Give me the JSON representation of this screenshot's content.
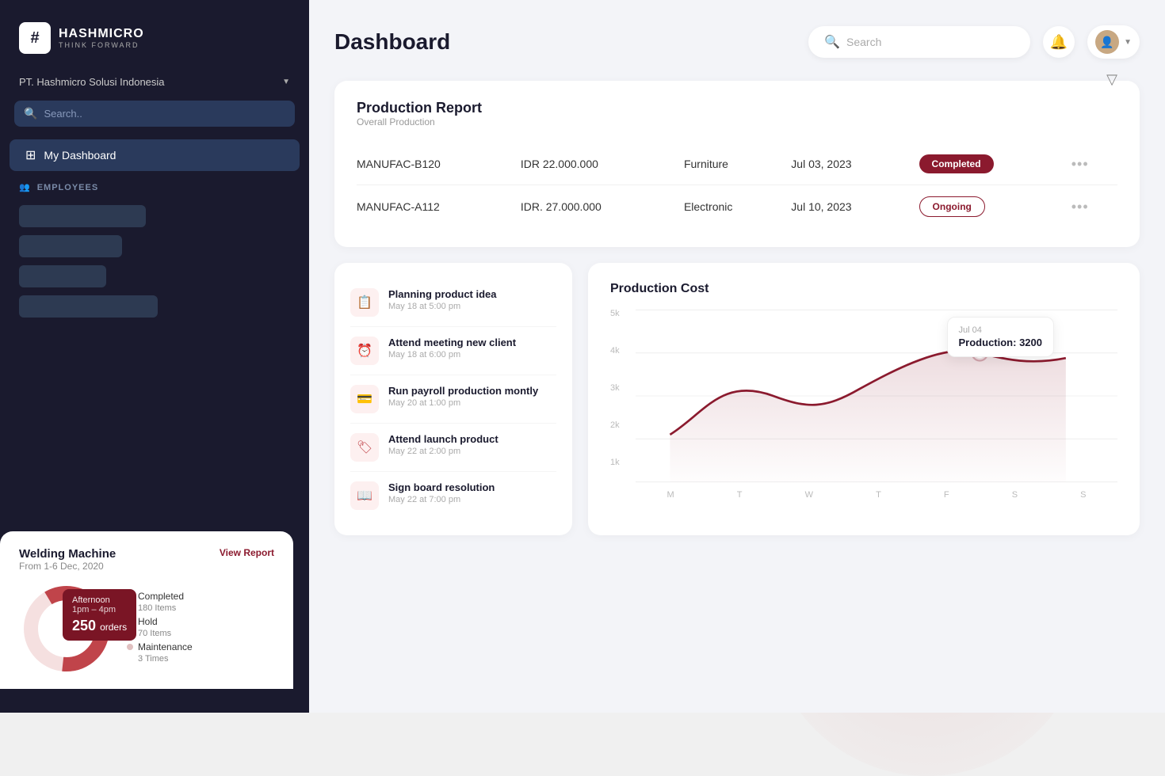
{
  "app": {
    "brand": "HASHMICRO",
    "tagline": "THINK FORWARD",
    "logo_hash": "#"
  },
  "sidebar": {
    "company": "PT. Hashmicro Solusi Indonesia",
    "search_placeholder": "Search..",
    "nav": [
      {
        "id": "dashboard",
        "label": "My Dashboard",
        "active": true
      }
    ],
    "section_employees": "EMPLOYEES"
  },
  "header": {
    "title": "Dashboard",
    "search_placeholder": "Search",
    "notif_icon": "🔔",
    "avatar_initial": "👤"
  },
  "production_report": {
    "title": "Production Report",
    "subtitle": "Overall Production",
    "filter_icon": "▽",
    "rows": [
      {
        "id": "MANUFAC-B120",
        "amount": "IDR 22.000.000",
        "category": "Furniture",
        "date": "Jul 03, 2023",
        "status": "Completed",
        "status_type": "completed"
      },
      {
        "id": "MANUFAC-A112",
        "amount": "IDR. 27.000.000",
        "category": "Electronic",
        "date": "Jul 10, 2023",
        "status": "Ongoing",
        "status_type": "ongoing"
      }
    ]
  },
  "activities": [
    {
      "id": 1,
      "title": "Planning product idea",
      "time": "May 18 at 5:00 pm",
      "icon": "📋"
    },
    {
      "id": 2,
      "title": "Attend meeting new client",
      "time": "May 18 at 6:00 pm",
      "icon": "⏰"
    },
    {
      "id": 3,
      "title": "Run payroll production montly",
      "time": "May 20 at 1:00 pm",
      "icon": "💳"
    },
    {
      "id": 4,
      "title": "Attend launch product",
      "time": "May 22 at 2:00 pm",
      "icon": "🏷"
    },
    {
      "id": 5,
      "title": "Sign board resolution",
      "time": "May 22 at 7:00 pm",
      "icon": "📖"
    }
  ],
  "production_cost": {
    "title": "Production Cost",
    "tooltip": {
      "date": "Jul 04",
      "label": "Production:",
      "value": "3200"
    },
    "y_labels": [
      "5k",
      "4k",
      "3k",
      "2k",
      "1k"
    ],
    "x_labels": [
      "M",
      "T",
      "W",
      "T",
      "F",
      "S",
      "S"
    ]
  },
  "widget": {
    "title": "Welding Machine",
    "date_range": "From 1-6 Dec, 2020",
    "view_report": "View Report",
    "tooltip": {
      "shift": "Afternoon",
      "time": "1pm – 4pm",
      "orders_label": "orders",
      "orders_value": "250"
    },
    "legend": [
      {
        "label": "Completed",
        "sub": "180 Items",
        "color": "#c0444a"
      },
      {
        "label": "Hold",
        "sub": "70 Items",
        "color": "#f4a0a0"
      },
      {
        "label": "Maintenance",
        "sub": "3 Times",
        "color": "#e0c0c0"
      }
    ]
  }
}
